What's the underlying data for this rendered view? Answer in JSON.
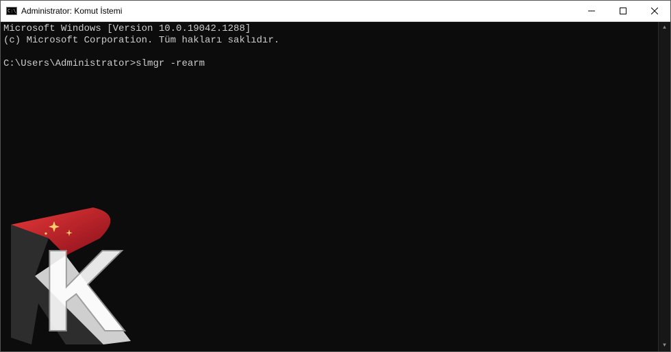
{
  "titlebar": {
    "title": "Administrator: Komut İstemi"
  },
  "console": {
    "line1": "Microsoft Windows [Version 10.0.19042.1288]",
    "line2": "(c) Microsoft Corporation. Tüm hakları saklıdır.",
    "prompt": "C:\\Users\\Administrator>",
    "command": "slmgr -rearm"
  }
}
